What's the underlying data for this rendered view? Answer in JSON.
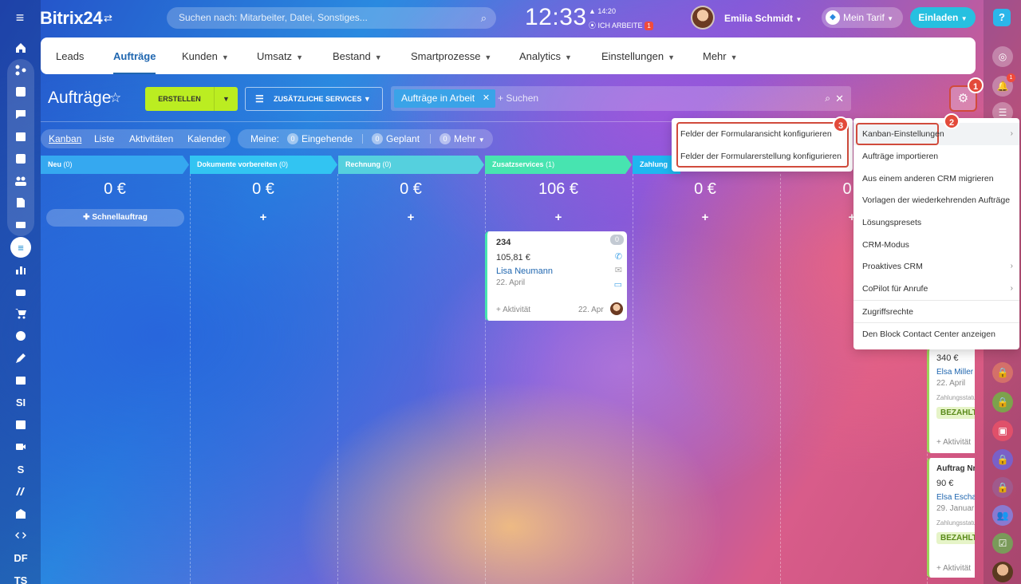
{
  "header": {
    "logo": "Bitrix24",
    "search_placeholder": "Suchen nach: Mitarbeiter, Datei, Sonstiges...",
    "clock": "12:33",
    "work_time": "14:20",
    "work_status": "ICH ARBEITE",
    "work_badge": "1",
    "user_name": "Emilia Schmidt",
    "tariff_label": "Mein Tarif",
    "invite_label": "Einladen",
    "help": "?"
  },
  "nav": {
    "items": [
      "Leads",
      "Aufträge",
      "Kunden",
      "Umsatz",
      "Bestand",
      "Smartprozesse",
      "Analytics",
      "Einstellungen",
      "Mehr"
    ],
    "active": "Aufträge"
  },
  "toolbar": {
    "title": "Aufträge",
    "create_label": "ERSTELLEN",
    "services_label": "ZUSÄTZLICHE SERVICES",
    "filter_chip": "Aufträge in Arbeit",
    "search_placeholder": "+ Suchen"
  },
  "views": {
    "items": [
      "Kanban",
      "Liste",
      "Aktivitäten",
      "Kalender"
    ],
    "active": "Kanban"
  },
  "mine": {
    "label": "Meine:",
    "incoming_count": "0",
    "incoming": "Eingehende",
    "planned_count": "0",
    "planned": "Geplant",
    "more_count": "0",
    "more": "Mehr"
  },
  "columns": [
    {
      "name": "Neu",
      "count": "(0)",
      "sum": "0 €",
      "color": "#35a8f0"
    },
    {
      "name": "Dokumente vorbereiten",
      "count": "(0)",
      "sum": "0 €",
      "color": "#32c4f2"
    },
    {
      "name": "Rechnung",
      "count": "(0)",
      "sum": "0 €",
      "color": "#55d0de"
    },
    {
      "name": "Zusatzservices",
      "count": "(1)",
      "sum": "106 €",
      "color": "#47e4b0"
    },
    {
      "name": "Zahlung",
      "count": "",
      "sum": "0 €",
      "color": "#1fb6f0"
    },
    {
      "name": "",
      "count": "",
      "sum": "0",
      "color": "#6fd0e8"
    }
  ],
  "quick_order": "Schnellauftrag",
  "card": {
    "number": "234",
    "amount": "105,81 €",
    "contact": "Lisa Neumann",
    "date": "22. April",
    "activity": "+ Aktivität",
    "activity_date": "22. Apr",
    "badge": "0"
  },
  "partial_cards": [
    {
      "amount": "340 €",
      "contact": "Elsa Miller",
      "date": "22. April",
      "field": "Zahlungsstatus",
      "status": "BEZAHLT",
      "activity": "+ Aktivität"
    },
    {
      "title": "Auftrag Nr",
      "amount": "90 €",
      "contact": "Elsa Eschauer",
      "date": "29. Januar",
      "field": "Zahlungsstatus",
      "status": "BEZAHLT",
      "activity": "+ Aktivität"
    }
  ],
  "form_menu": {
    "items": [
      "Felder der Formularansicht konfigurieren",
      "Felder der Formularerstellung konfigurieren"
    ]
  },
  "settings_menu": {
    "items": [
      "Kanban-Einstellungen",
      "Aufträge importieren",
      "Aus einem anderen CRM migrieren",
      "Vorlagen der wiederkehrenden Aufträge",
      "Lösungspresets",
      "CRM-Modus",
      "Proaktives CRM",
      "CoPilot für Anrufe",
      "Zugriffsrechte",
      "Den Block Contact Center anzeigen"
    ]
  },
  "steps": [
    "1",
    "2",
    "3"
  ],
  "left_sidebar": {
    "labels": [
      "SI",
      "S",
      "DF",
      "TS"
    ]
  },
  "right_sidebar": {
    "notification_badge": "1"
  }
}
